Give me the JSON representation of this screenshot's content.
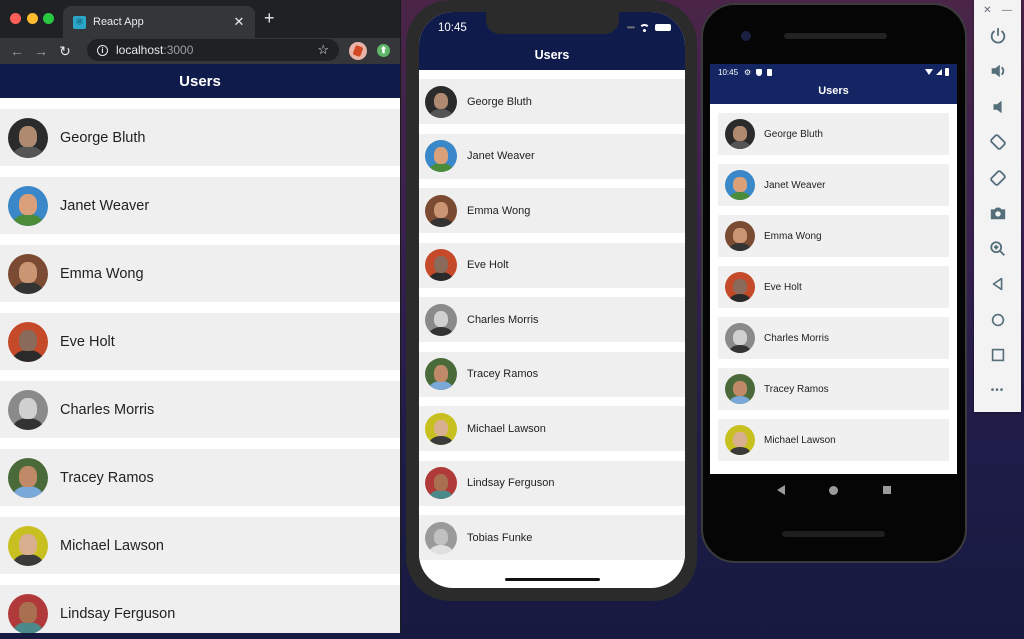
{
  "browser": {
    "tab_title": "React App",
    "tab_close": "✕",
    "new_tab": "+",
    "url_host": "localhost",
    "url_port": ":3000",
    "back": "←",
    "forward": "→",
    "reload": "↻",
    "star": "☆",
    "ext2_glyph": "⬆"
  },
  "app": {
    "title": "Users",
    "header_color": "#0f1b4a"
  },
  "users": [
    {
      "name": "George Bluth",
      "skin": "#b08a70",
      "bg": "#2b2b2b",
      "shirt": "#555"
    },
    {
      "name": "Janet Weaver",
      "skin": "#d9a07a",
      "bg": "#3a87c9",
      "shirt": "#4a8c3a"
    },
    {
      "name": "Emma Wong",
      "skin": "#c99572",
      "bg": "#7a4a32",
      "shirt": "#333"
    },
    {
      "name": "Eve Holt",
      "skin": "#8a6a5a",
      "bg": "#c44a2a",
      "shirt": "#2a2a2a"
    },
    {
      "name": "Charles Morris",
      "skin": "#d0d0d0",
      "bg": "#8a8a8a",
      "shirt": "#333"
    },
    {
      "name": "Tracey Ramos",
      "skin": "#c08a68",
      "bg": "#4a6a3a",
      "shirt": "#7aa8d8"
    },
    {
      "name": "Michael Lawson",
      "skin": "#d8b090",
      "bg": "#c8c020",
      "shirt": "#3a3a3a"
    },
    {
      "name": "Lindsay Ferguson",
      "skin": "#a87050",
      "bg": "#b03a3a",
      "shirt": "#4a8a8a"
    },
    {
      "name": "Tobias Funke",
      "skin": "#c0c0c0",
      "bg": "#9a9a9a",
      "shirt": "#e0e0e0"
    }
  ],
  "ios": {
    "time": "10:45",
    "title": "Users"
  },
  "android": {
    "time": "10:45",
    "gear": "⚙",
    "title": "Users"
  },
  "emulator_panel": {
    "close": "✕",
    "minimize": "—",
    "buttons": [
      "power",
      "volume-up",
      "volume-down",
      "rotate-left",
      "rotate-right",
      "screenshot",
      "zoom",
      "back",
      "home",
      "overview",
      "more"
    ],
    "more_glyph": "•••"
  }
}
